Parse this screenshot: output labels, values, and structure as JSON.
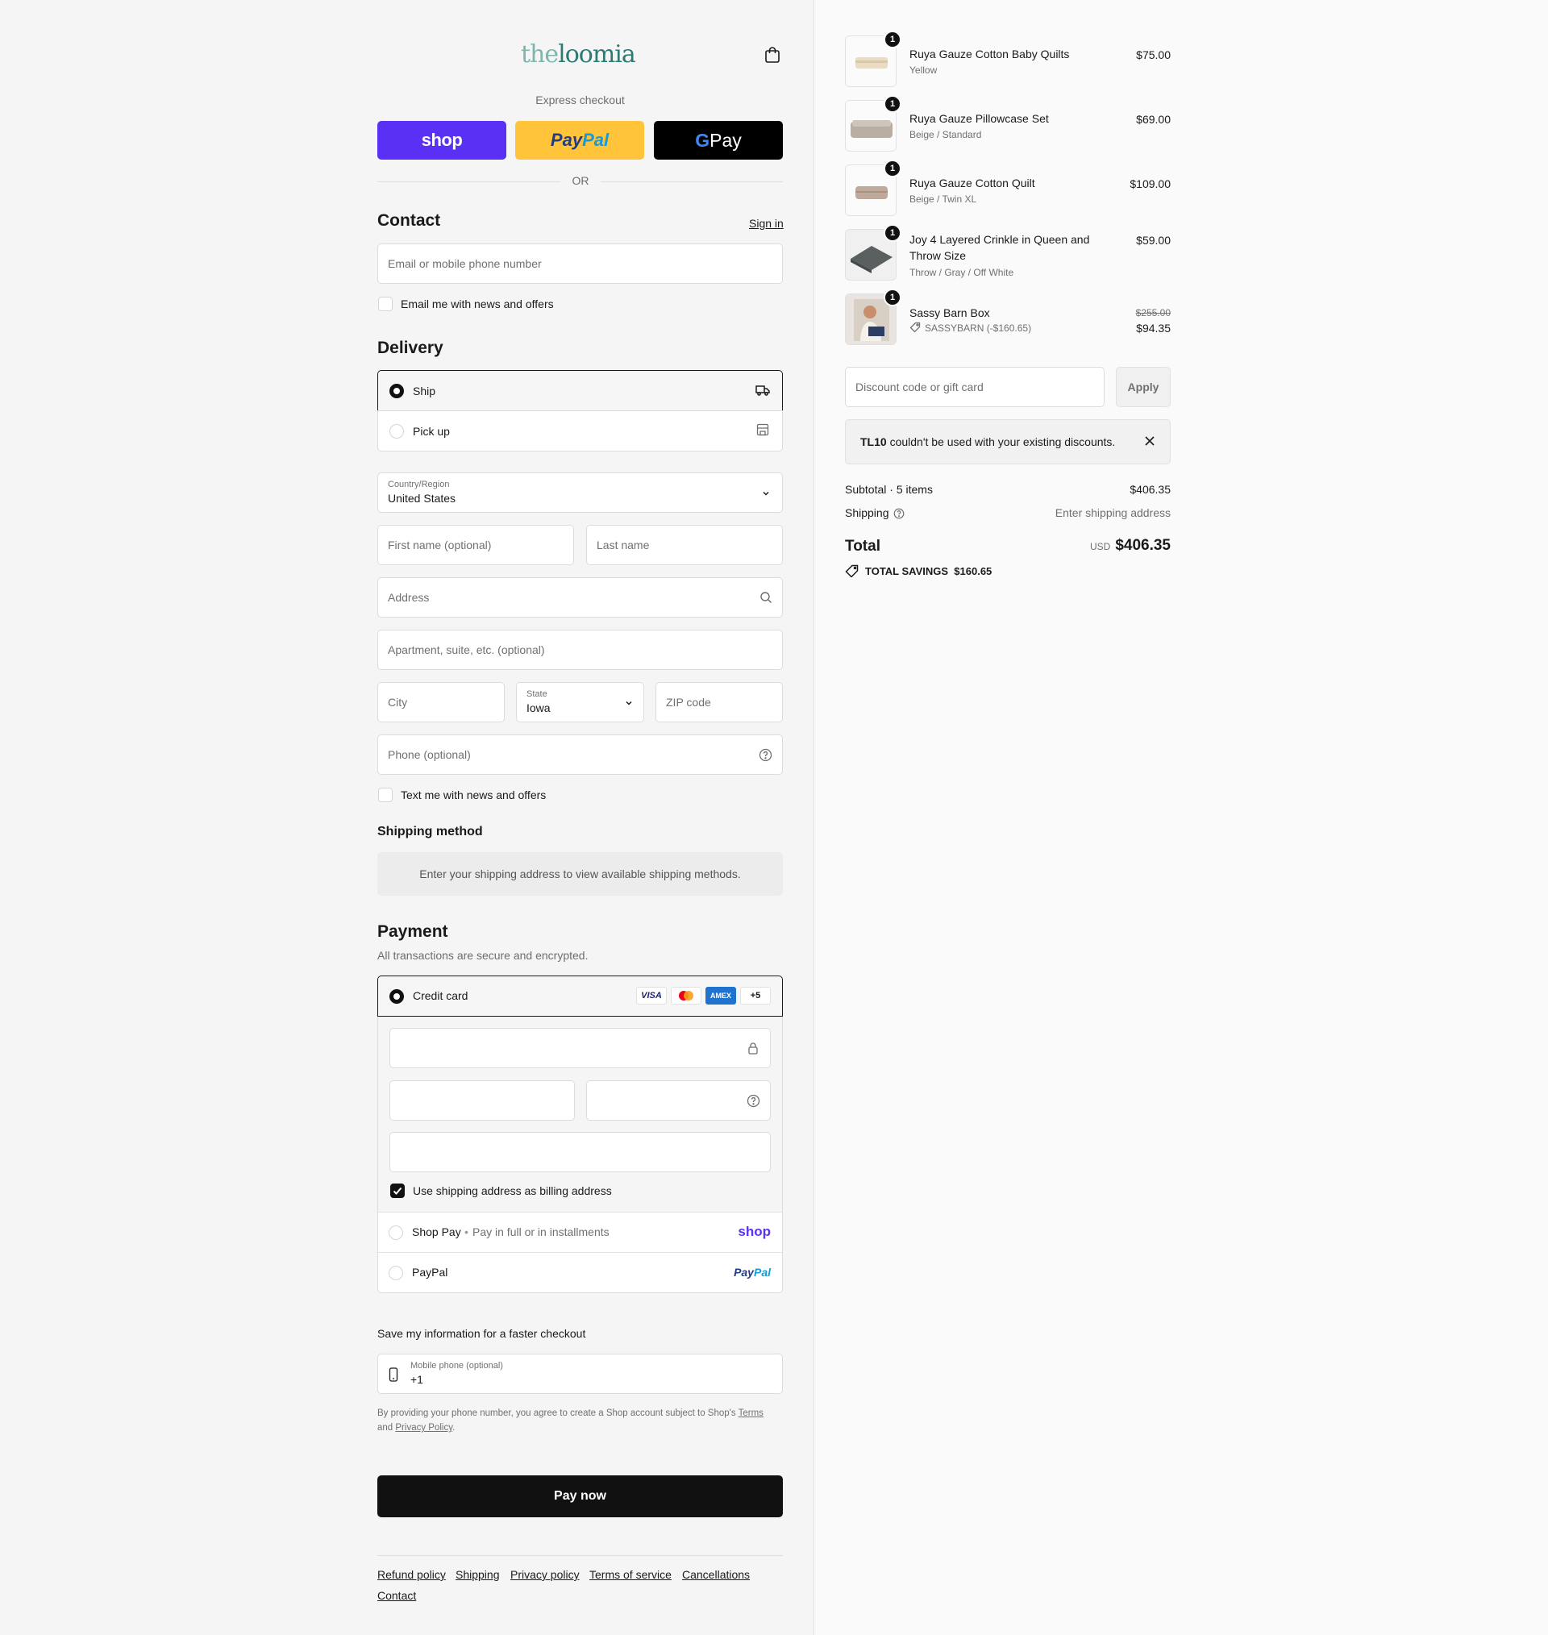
{
  "brand": {
    "logo_a": "the",
    "logo_b": "loomia"
  },
  "express": {
    "title": "Express checkout",
    "shop": "shop",
    "paypal_a": "Pay",
    "paypal_b": "Pal",
    "gpay_g": "G",
    "gpay": " Pay",
    "or": "OR"
  },
  "contact": {
    "title": "Contact",
    "signin": "Sign in",
    "email_placeholder": "Email or mobile phone number",
    "news_label": "Email me with news and offers"
  },
  "delivery": {
    "title": "Delivery",
    "ship": "Ship",
    "pickup": "Pick up",
    "country_label": "Country/Region",
    "country_value": "United States",
    "first_name": "First name (optional)",
    "last_name": "Last name",
    "address": "Address",
    "apartment": "Apartment, suite, etc. (optional)",
    "city": "City",
    "state_label": "State",
    "state_value": "Iowa",
    "zip": "ZIP code",
    "phone": "Phone (optional)",
    "text_news": "Text me with news and offers"
  },
  "shipping_method": {
    "title": "Shipping method",
    "notice": "Enter your shipping address to view available shipping methods."
  },
  "payment": {
    "title": "Payment",
    "subtitle": "All transactions are secure and encrypted.",
    "credit_card": "Credit card",
    "cards": [
      "VISA",
      "MC",
      "AMEX",
      "+5"
    ],
    "billing_same": "Use shipping address as billing address",
    "shop_pay": "Shop Pay",
    "shop_pay_sub": "Pay in full or in installments",
    "shop_logo": "shop",
    "paypal": "PayPal",
    "paypal_logo_a": "Pay",
    "paypal_logo_b": "Pal"
  },
  "save_info": {
    "title": "Save my information for a faster checkout",
    "mobile_label": "Mobile phone (optional)",
    "mobile_value": "+1",
    "disclaimer_a": "By providing your phone number, you agree to create a Shop account subject to Shop's",
    "terms": "Terms",
    "and": "and",
    "privacy": "Privacy Policy",
    "period": "."
  },
  "pay_now": "Pay now",
  "footer": {
    "refund": "Refund policy",
    "shipping": "Shipping",
    "privacy": "Privacy policy",
    "terms": "Terms of service",
    "cancellations": "Cancellations",
    "contact": "Contact"
  },
  "cart": {
    "items": [
      {
        "qty": "1",
        "name": "Ruya Gauze Cotton Baby Quilts",
        "variant": "Yellow",
        "price": "$75.00"
      },
      {
        "qty": "1",
        "name": "Ruya Gauze Pillowcase Set",
        "variant": "Beige / Standard",
        "price": "$69.00"
      },
      {
        "qty": "1",
        "name": "Ruya Gauze Cotton Quilt",
        "variant": "Beige / Twin XL",
        "price": "$109.00"
      },
      {
        "qty": "1",
        "name": "Joy 4 Layered Crinkle in Queen and Throw Size",
        "variant": "Throw / Gray / Off White",
        "price": "$59.00"
      },
      {
        "qty": "1",
        "name": "Sassy Barn Box",
        "variant": "SASSYBARN (-$160.65)",
        "price_old": "$255.00",
        "price": "$94.35"
      }
    ],
    "discount_placeholder": "Discount code or gift card",
    "apply": "Apply",
    "alert_code": "TL10",
    "alert_text": " couldn't be used with your existing discounts.",
    "subtotal_label": "Subtotal · 5 items",
    "subtotal_value": "$406.35",
    "shipping_label": "Shipping",
    "shipping_value": "Enter shipping address",
    "total_label": "Total",
    "currency": "USD",
    "total_value": "$406.35",
    "savings_label": "TOTAL SAVINGS",
    "savings_value": "$160.65"
  }
}
